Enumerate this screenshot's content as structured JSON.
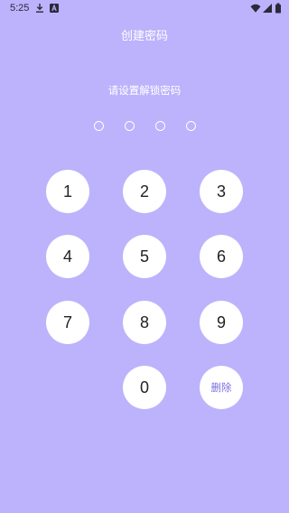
{
  "status_bar": {
    "time": "5:25",
    "icons_left": [
      "download-icon",
      "keyboard-a-icon"
    ],
    "icons_right": [
      "wifi-icon",
      "cellular-signal-icon",
      "battery-icon"
    ]
  },
  "header": {
    "title": "创建密码"
  },
  "prompt": {
    "text": "请设置解锁密码"
  },
  "pin": {
    "length": 4,
    "filled": 0
  },
  "keypad": {
    "keys": [
      "1",
      "2",
      "3",
      "4",
      "5",
      "6",
      "7",
      "8",
      "9",
      "0"
    ],
    "delete_label": "删除"
  },
  "colors": {
    "background": "#bcb3fc",
    "accent": "#7b6fe0",
    "key_background": "#ffffff"
  }
}
